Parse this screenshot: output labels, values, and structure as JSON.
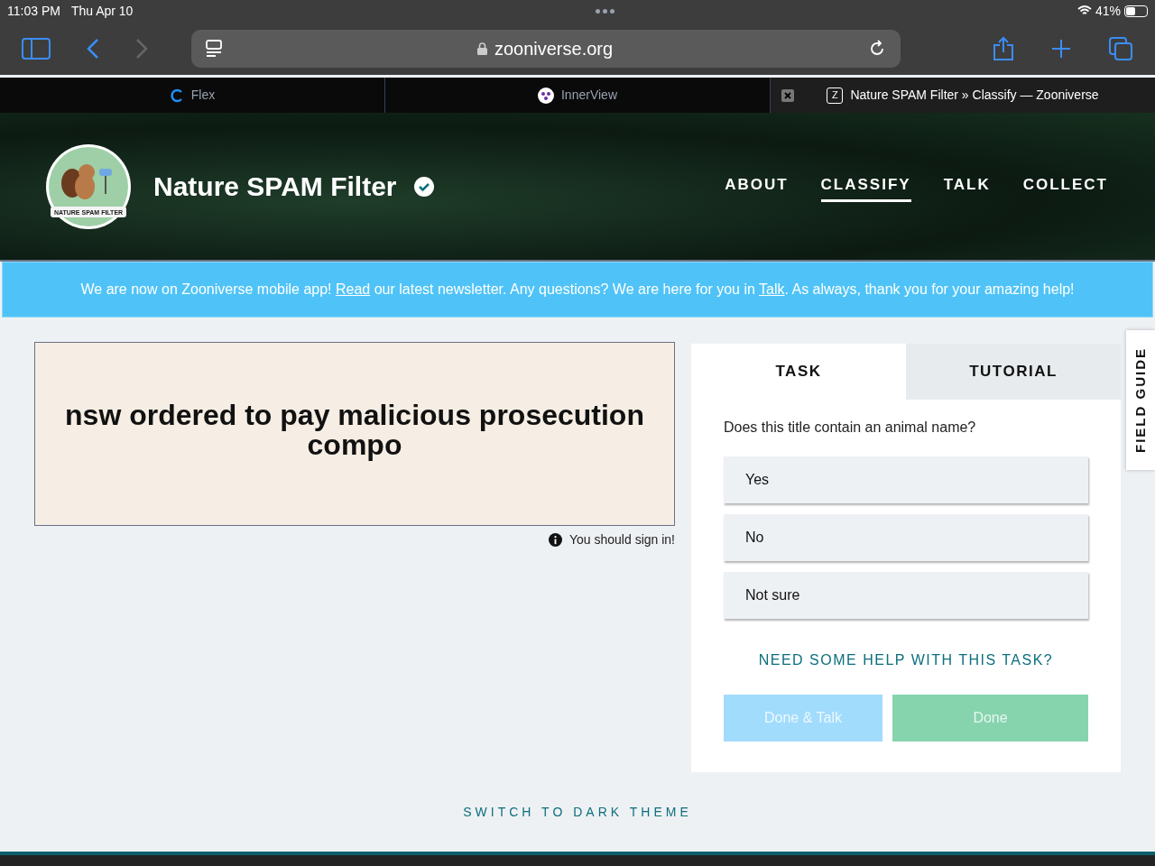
{
  "status_bar": {
    "time": "11:03 PM",
    "date": "Thu Apr 10",
    "battery": "41%"
  },
  "address_bar": {
    "url": "zooniverse.org"
  },
  "browser_tabs": [
    {
      "label": "Flex",
      "selected": false,
      "kind": "flex"
    },
    {
      "label": "InnerView",
      "selected": false,
      "kind": "innerview"
    },
    {
      "label": "Nature SPAM Filter » Classify — Zooniverse",
      "selected": true,
      "kind": "zooniverse",
      "favicon": "Z"
    }
  ],
  "project": {
    "title": "Nature SPAM Filter",
    "logo_text": "NATURE SPAM FILTER",
    "verified": true
  },
  "nav": [
    {
      "label": "ABOUT",
      "selected": false
    },
    {
      "label": "CLASSIFY",
      "selected": true
    },
    {
      "label": "TALK",
      "selected": false
    },
    {
      "label": "COLLECT",
      "selected": false
    }
  ],
  "banner": {
    "parts": [
      {
        "kind": "text",
        "text": "We are now on Zooniverse mobile app! "
      },
      {
        "kind": "link",
        "text": "Read"
      },
      {
        "kind": "text",
        "text": " our latest newsletter. Any questions? We are here for you in "
      },
      {
        "kind": "link",
        "text": "Talk"
      },
      {
        "kind": "text",
        "text": ". As always, thank you for your amazing help!"
      }
    ]
  },
  "subject": {
    "text": "nsw ordered to pay malicious prosecution compo",
    "note": "You should sign in!"
  },
  "task_tabs": [
    {
      "label": "TASK",
      "selected": true
    },
    {
      "label": "TUTORIAL",
      "selected": false
    }
  ],
  "task": {
    "question": "Does this title contain an animal name?",
    "answers": [
      {
        "label": "Yes",
        "selected": false
      },
      {
        "label": "No",
        "selected": false
      },
      {
        "label": "Not sure",
        "selected": false
      }
    ],
    "help_link": "NEED SOME HELP WITH THIS TASK?",
    "buttons": [
      {
        "label": "Done & Talk",
        "kind": "talk",
        "disabled": true
      },
      {
        "label": "Done",
        "kind": "done",
        "disabled": true
      }
    ]
  },
  "field_guide": "FIELD GUIDE",
  "footer": {
    "theme_link": "SWITCH TO DARK THEME"
  }
}
